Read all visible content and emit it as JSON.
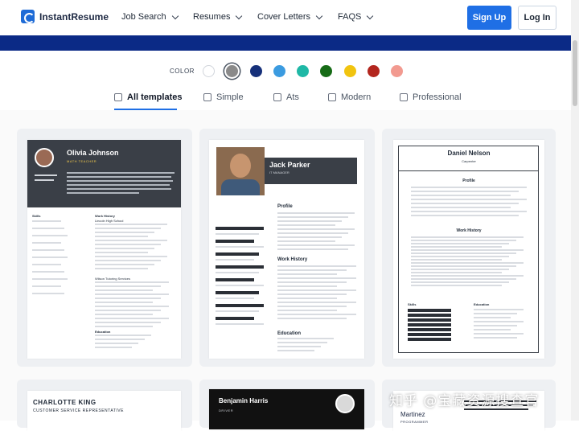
{
  "brand": {
    "name": "InstantResume"
  },
  "nav": {
    "items": [
      {
        "label": "Job Search"
      },
      {
        "label": "Resumes"
      },
      {
        "label": "Cover Letters"
      },
      {
        "label": "FAQS"
      }
    ],
    "signup": "Sign Up",
    "login": "Log In"
  },
  "color_picker": {
    "label": "COLOR",
    "swatches": [
      "#ffffff",
      "#8a8a8a",
      "#16307a",
      "#3b9be0",
      "#1fb8a6",
      "#166b16",
      "#f1c40f",
      "#b3261e",
      "#f29a90"
    ],
    "selected": "#8a8a8a"
  },
  "tabs": [
    {
      "label": "All templates",
      "icon": "copy-icon",
      "active": true
    },
    {
      "label": "Simple",
      "icon": "layers-icon",
      "active": false
    },
    {
      "label": "Ats",
      "icon": "resize-icon",
      "active": false
    },
    {
      "label": "Modern",
      "icon": "trophy-icon",
      "active": false
    },
    {
      "label": "Professional",
      "icon": "book-icon",
      "active": false
    }
  ],
  "templates": [
    {
      "name": "Olivia Johnson",
      "role": "MATH TEACHER",
      "sections": [
        "Skills",
        "Work History",
        "Education"
      ],
      "jobs": [
        "Lincoln High School",
        "Wilson Tutoring Services"
      ]
    },
    {
      "name": "Jack Parker",
      "role": "IT MANAGER",
      "sections": [
        "Profile",
        "Work History",
        "Education"
      ]
    },
    {
      "name": "Daniel Nelson",
      "role": "Carpenter",
      "sections": [
        "Profile",
        "Work History",
        "Skills",
        "Education"
      ]
    },
    {
      "name": "CHARLOTTE KING",
      "role": "CUSTOMER SERVICE REPRESENTATIVE"
    },
    {
      "name": "Benjamin Harris",
      "role": "DRIVER"
    },
    {
      "name": "Martinez",
      "role": "PROGRAMMER"
    }
  ],
  "watermark": "知乎 @宝藏资源搜查官"
}
